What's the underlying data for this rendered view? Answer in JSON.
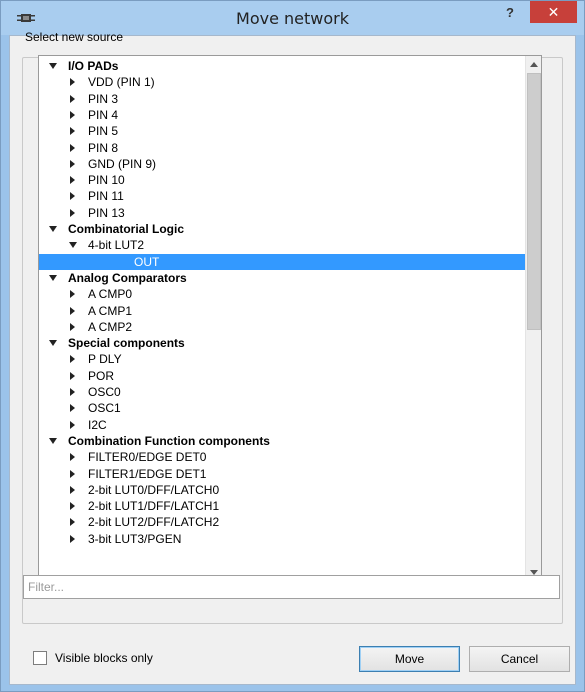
{
  "window": {
    "title": "Move network",
    "help_label": "?",
    "close_label": "✕",
    "icon": "app-chip-icon",
    "title_bar_color": "#a9cdef",
    "close_color": "#c7403a"
  },
  "dialog": {
    "group_label": "Select new source",
    "filter_placeholder": "Filter...",
    "filter_value": "",
    "visible_blocks_label": "Visible blocks only",
    "visible_blocks_checked": false,
    "move_label": "Move",
    "cancel_label": "Cancel",
    "selection_color": "#3399ff"
  },
  "tree": [
    {
      "label": "I/O PADs",
      "level": 0,
      "expander": "expanded",
      "bold": true
    },
    {
      "label": "VDD (PIN 1)",
      "level": 1,
      "expander": "collapsed"
    },
    {
      "label": "PIN 3",
      "level": 1,
      "expander": "collapsed"
    },
    {
      "label": "PIN 4",
      "level": 1,
      "expander": "collapsed"
    },
    {
      "label": "PIN 5",
      "level": 1,
      "expander": "collapsed"
    },
    {
      "label": "PIN 8",
      "level": 1,
      "expander": "collapsed"
    },
    {
      "label": "GND (PIN 9)",
      "level": 1,
      "expander": "collapsed"
    },
    {
      "label": "PIN 10",
      "level": 1,
      "expander": "collapsed"
    },
    {
      "label": "PIN 11",
      "level": 1,
      "expander": "collapsed"
    },
    {
      "label": "PIN 13",
      "level": 1,
      "expander": "collapsed"
    },
    {
      "label": "Combinatorial Logic",
      "level": 0,
      "expander": "expanded",
      "bold": true
    },
    {
      "label": "4-bit LUT2",
      "level": 1,
      "expander": "expanded"
    },
    {
      "label": "OUT",
      "level": 2,
      "expander": "none",
      "selected": true
    },
    {
      "label": "Analog Comparators",
      "level": 0,
      "expander": "expanded",
      "bold": true
    },
    {
      "label": "A CMP0",
      "level": 1,
      "expander": "collapsed"
    },
    {
      "label": "A CMP1",
      "level": 1,
      "expander": "collapsed"
    },
    {
      "label": "A CMP2",
      "level": 1,
      "expander": "collapsed"
    },
    {
      "label": "Special components",
      "level": 0,
      "expander": "expanded",
      "bold": true
    },
    {
      "label": "P DLY",
      "level": 1,
      "expander": "collapsed"
    },
    {
      "label": "POR",
      "level": 1,
      "expander": "collapsed"
    },
    {
      "label": "OSC0",
      "level": 1,
      "expander": "collapsed"
    },
    {
      "label": "OSC1",
      "level": 1,
      "expander": "collapsed"
    },
    {
      "label": "I2C",
      "level": 1,
      "expander": "collapsed"
    },
    {
      "label": "Combination Function components",
      "level": 0,
      "expander": "expanded",
      "bold": true
    },
    {
      "label": "FILTER0/EDGE DET0",
      "level": 1,
      "expander": "collapsed"
    },
    {
      "label": "FILTER1/EDGE DET1",
      "level": 1,
      "expander": "collapsed"
    },
    {
      "label": "2-bit LUT0/DFF/LATCH0",
      "level": 1,
      "expander": "collapsed"
    },
    {
      "label": "2-bit LUT1/DFF/LATCH1",
      "level": 1,
      "expander": "collapsed"
    },
    {
      "label": "2-bit LUT2/DFF/LATCH2",
      "level": 1,
      "expander": "collapsed"
    },
    {
      "label": "3-bit LUT3/PGEN",
      "level": 1,
      "expander": "collapsed"
    }
  ],
  "scrollbar": {
    "position": 0.0,
    "visible_fraction": 0.52
  }
}
